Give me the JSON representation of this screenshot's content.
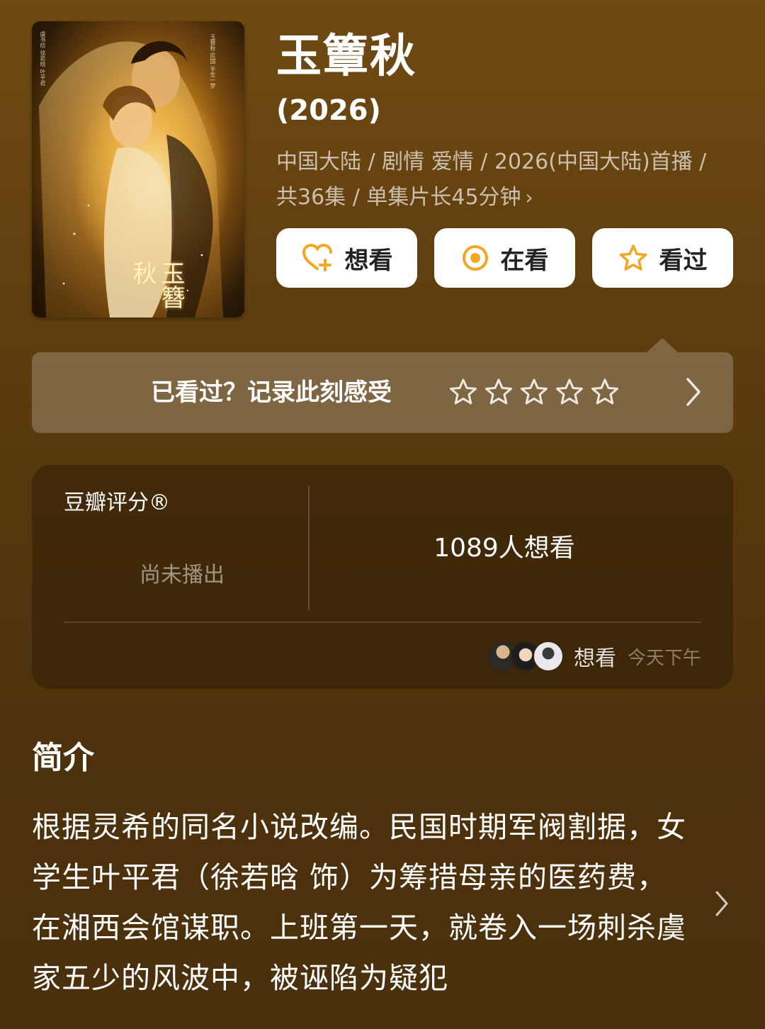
{
  "poster": {
    "vertical_title": "玉簪秋",
    "credits_left": "虞书欣 徐若晗 叶平君",
    "credits_right": "玉簪秋·民国 半生一梦"
  },
  "header": {
    "title": "玉簟秋",
    "year": "(2026)",
    "meta_text": "中国大陆 / 剧情 爱情 / 2026(中国大陆)首播 / 共36集 / 单集片长45分钟",
    "meta_chevron": "›"
  },
  "actions": {
    "want_label": "想看",
    "watching_label": "在看",
    "watched_label": "看过"
  },
  "rating_prompt": {
    "text": "已看过？记录此刻感受",
    "star_count": 5
  },
  "score": {
    "label": "豆瓣评分®",
    "status": "尚未播出",
    "want_count_text": "1089人想看",
    "activity_label": "想看",
    "activity_time": "今天下午"
  },
  "intro": {
    "heading": "简介",
    "text": "根据灵希的同名小说改编。民国时期军阀割据，女学生叶平君（徐若晗 饰）为筹措母亲的医药费，在湘西会馆谋职。上班第一天，就卷入一场刺杀虞家五少的风波中，被诬陷为疑犯"
  },
  "colors": {
    "background_top": "#6f4a12",
    "background_bottom": "#4a300c",
    "accent_orange": "#f5a623",
    "button_bg": "#ffffff"
  }
}
